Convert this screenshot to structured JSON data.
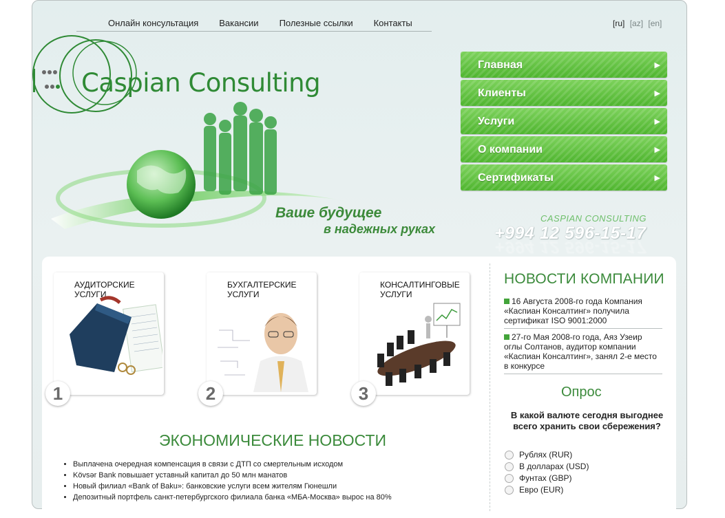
{
  "top_nav": [
    "Онлайн консультация",
    "Вакансии",
    "Полезные ссылки",
    "Контакты"
  ],
  "languages": [
    "[ru]",
    "[az]",
    "[en]"
  ],
  "brand": {
    "name": "Caspian Consulting",
    "color": "#2f8a35"
  },
  "tagline": {
    "line1": "Ваше будущее",
    "line2": "в надежных руках"
  },
  "contact": {
    "label": "CASPIAN CONSULTING",
    "phone": "+994 12 596-15-17"
  },
  "main_menu": [
    "Главная",
    "Клиенты",
    "Услуги",
    "О компании",
    "Сертификаты"
  ],
  "services": [
    {
      "title": "АУДИТОРСКИЕ УСЛУГИ",
      "number": "1"
    },
    {
      "title": "БУХГАЛТЕРСКИЕ УСЛУГИ",
      "number": "2"
    },
    {
      "title": "КОНСАЛТИНГОВЫЕ УСЛУГИ",
      "number": "3"
    }
  ],
  "economic_news": {
    "title": "ЭКОНОМИЧЕСКИЕ НОВОСТИ",
    "items": [
      "Выплачена очередная компенсация в связи с ДТП со смертельным исходом",
      "Kövsər Bank повышает уставный капитал до 50 млн манатов",
      "Новый филиал «Bank of Baku»: банковские услуги всем жителям Гюнешли",
      "Депозитный портфель санкт-петербургского филиала банка «МБА-Москва» вырос на 80%"
    ]
  },
  "company_news": {
    "title": "НОВОСТИ КОМПАНИИ",
    "items": [
      "16 Августа 2008-го года Компания «Каспиан Консалтинг» получила сертификат ISO 9001:2000",
      "27-го Мая 2008-го года, Аяз Узеир оглы Солтанов, аудитор компании «Каспиан Консалтинг», занял 2-е место в конкурсе"
    ]
  },
  "poll": {
    "title": "Опрос",
    "question": "В какой валюте сегодня выгоднее всего хранить свои сбережения?",
    "options": [
      "Рублях (RUR)",
      "В долларах (USD)",
      "Фунтах (GBP)",
      "Евро (EUR)"
    ]
  },
  "colors": {
    "accent_green": "#3b8a3b",
    "menu_green": "#5cbf3a"
  }
}
